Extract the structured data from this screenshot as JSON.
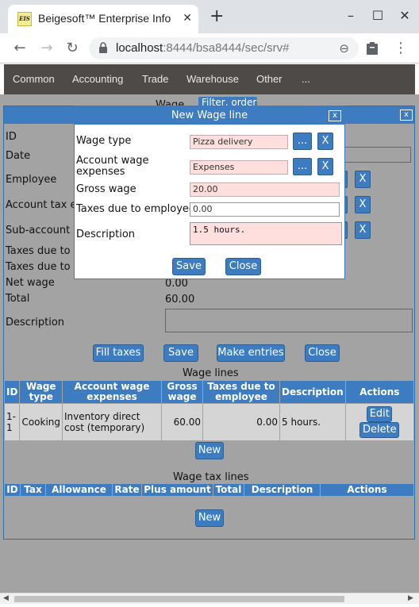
{
  "browser": {
    "tab_title": "Beigesoft™ Enterprise Info",
    "favicon_text": "EIS",
    "url_host": "localhost",
    "url_path": ":8444/bsa8444/sec/srv#"
  },
  "menu": {
    "items": [
      "Common",
      "Accounting",
      "Trade",
      "Warehouse",
      "Other",
      "..."
    ]
  },
  "wage_form": {
    "title": "Wage",
    "filter_label": "Filter, order",
    "labels": {
      "id": "ID",
      "date": "Date",
      "employee": "Employee",
      "account_tax": "Account tax ex",
      "sub_account": "Sub-account",
      "taxes_due_1": "Taxes due to e",
      "taxes_due_2": "Taxes due to e",
      "net_wage": "Net wage",
      "total": "Total",
      "description": "Description"
    },
    "net_wage_value": "0.00",
    "total_value": "60.00",
    "buttons": {
      "fill_taxes": "Fill taxes",
      "save": "Save",
      "make_entries": "Make entries",
      "close": "Close"
    }
  },
  "wage_lines": {
    "title": "Wage lines",
    "headers": [
      "ID",
      "Wage type",
      "Account wage expenses",
      "Gross wage",
      "Taxes due to employee",
      "Description",
      "Actions"
    ],
    "rows": [
      {
        "id": "1-1",
        "wage_type": "Cooking",
        "account": "Inventory direct cost (temporary)",
        "gross": "60.00",
        "taxes": "0.00",
        "description": "5 hours.",
        "edit": "Edit",
        "delete": "Delete"
      }
    ],
    "new_label": "New"
  },
  "wage_tax_lines": {
    "title": "Wage tax lines",
    "headers": [
      "ID",
      "Tax",
      "Allowance",
      "Rate",
      "Plus amount",
      "Total",
      "Description",
      "Actions"
    ],
    "new_label": "New"
  },
  "modal": {
    "title": "New Wage line",
    "close_x": "x",
    "fields": {
      "wage_type_label": "Wage type",
      "wage_type_value": "Pizza delivery",
      "account_label": "Account wage expenses",
      "account_value": "Expenses",
      "gross_label": "Gross wage",
      "gross_value": "20.00",
      "taxes_label": "Taxes due to employee",
      "taxes_value": "0.00",
      "description_label": "Description",
      "description_value": "1.5 hours."
    },
    "pick_label": "...",
    "clear_label": "X",
    "save_label": "Save",
    "close_label": "Close"
  },
  "colors": {
    "accent": "#3d7cc0",
    "menu_bg": "#4d4a47",
    "page_bg": "#a3a3a3",
    "required_field": "#ffdede"
  }
}
